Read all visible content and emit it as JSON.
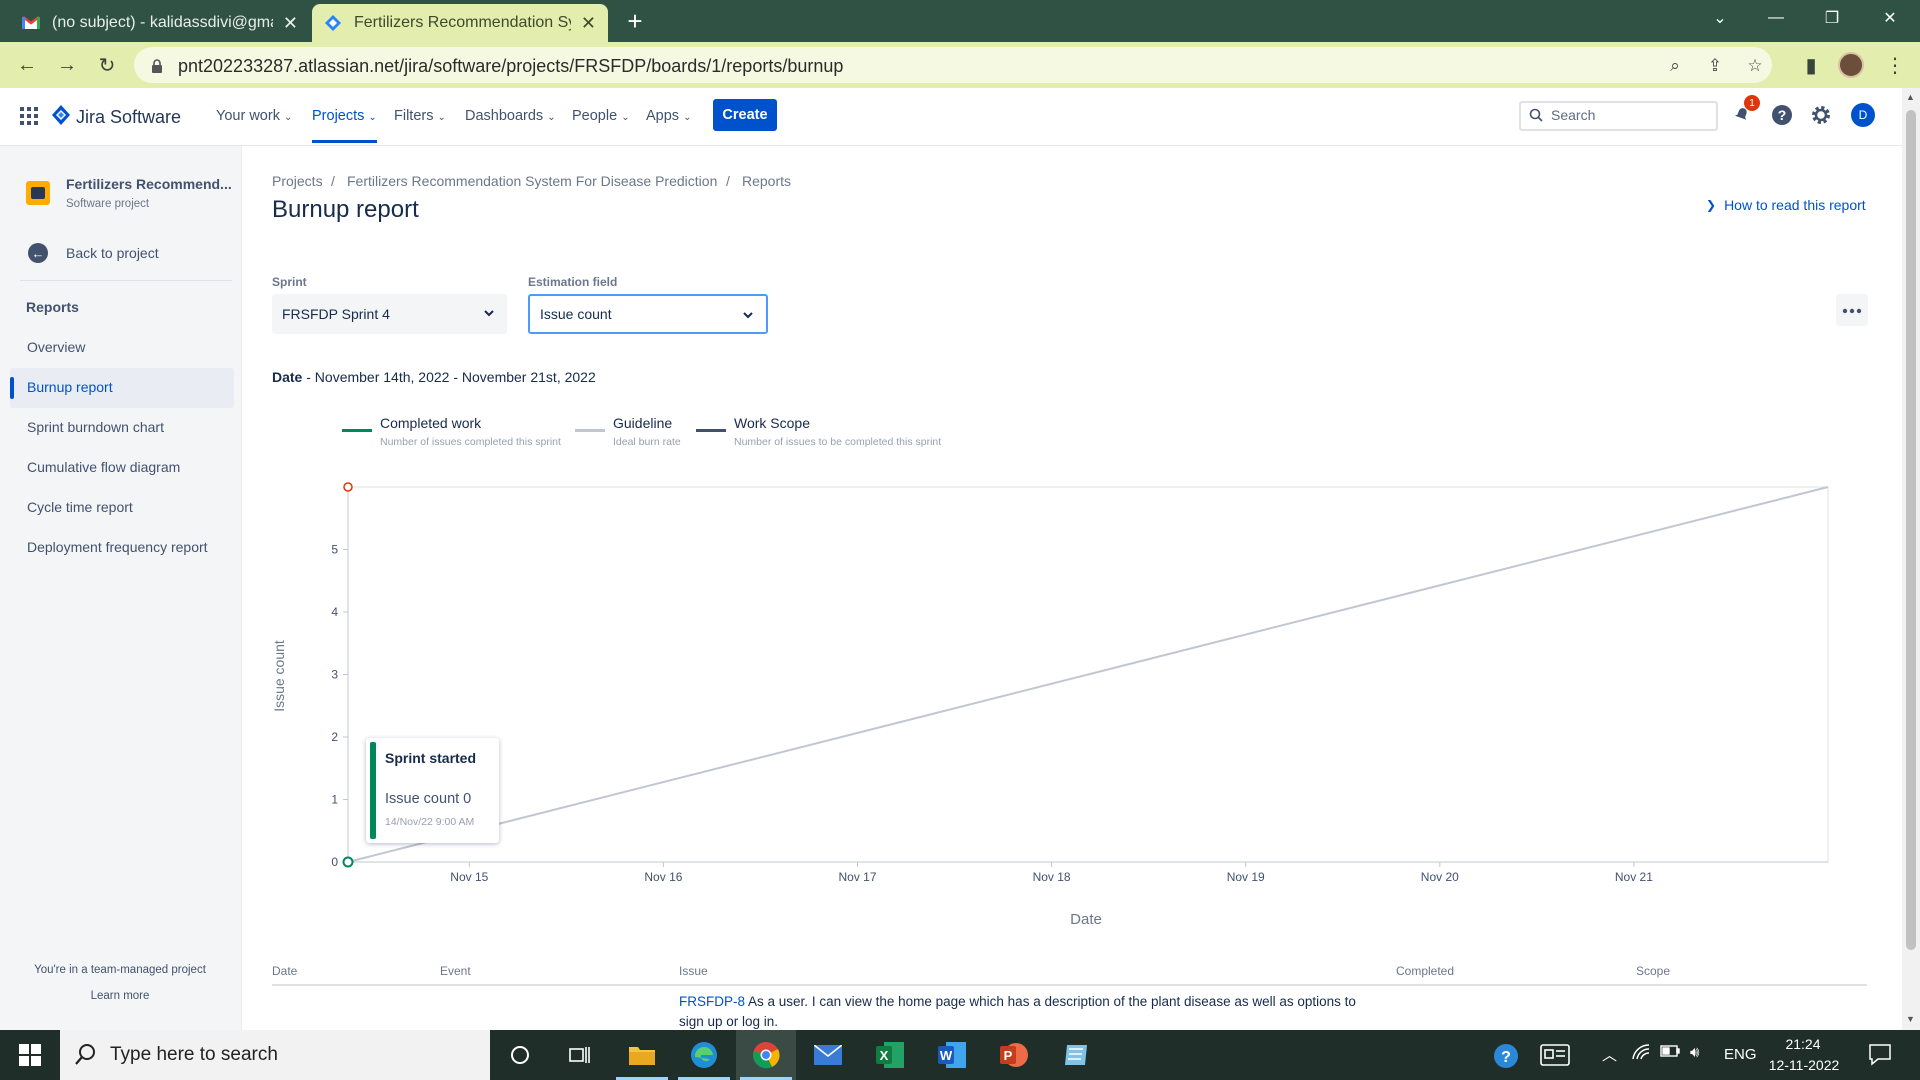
{
  "browser": {
    "tabs": [
      {
        "title": "(no subject) - kalidassdivi@gmail.com",
        "active": false,
        "icon": "gmail-icon"
      },
      {
        "title": "Fertilizers Recommendation System For Disease Prediction",
        "active": true,
        "icon": "jira-icon"
      }
    ],
    "url": "pnt202233287.atlassian.net/jira/software/projects/FRSFDP/boards/1/reports/burnup"
  },
  "jira_nav": {
    "product": "Jira Software",
    "items": [
      "Your work",
      "Projects",
      "Filters",
      "Dashboards",
      "People",
      "Apps"
    ],
    "active_item": "Projects",
    "create_label": "Create",
    "search_placeholder": "Search",
    "notification_count": "1",
    "avatar_initial": "D"
  },
  "sidebar": {
    "project_name": "Fertilizers Recommend...",
    "project_type": "Software project",
    "back_label": "Back to project",
    "section_title": "Reports",
    "items": [
      "Overview",
      "Burnup report",
      "Sprint burndown chart",
      "Cumulative flow diagram",
      "Cycle time report",
      "Deployment frequency report"
    ],
    "active_item": "Burnup report",
    "footer_text": "You're in a team-managed project",
    "footer_link": "Learn more"
  },
  "main": {
    "breadcrumb": [
      "Projects",
      "Fertilizers Recommendation System For Disease Prediction",
      "Reports"
    ],
    "title": "Burnup report",
    "help_link": "How to read this report",
    "sprint_label": "Sprint",
    "sprint_value": "FRSFDP Sprint 4",
    "estimation_label": "Estimation field",
    "estimation_value": "Issue count",
    "date_label": "Date",
    "date_range": "- November 14th, 2022 - November 21st, 2022"
  },
  "legend": [
    {
      "title": "Completed work",
      "sub": "Number of issues completed this sprint",
      "color": "#00875a"
    },
    {
      "title": "Guideline",
      "sub": "Ideal burn rate",
      "color": "#c1c7d0"
    },
    {
      "title": "Work Scope",
      "sub": "Number of issues to be completed this sprint",
      "color": "#42526e"
    }
  ],
  "chart_data": {
    "type": "line",
    "xlabel": "Date",
    "ylabel": "Issue count",
    "x_ticks": [
      "Nov 15",
      "Nov 16",
      "Nov 17",
      "Nov 18",
      "Nov 19",
      "Nov 20",
      "Nov 21"
    ],
    "y_ticks": [
      0,
      1,
      2,
      3,
      4,
      5
    ],
    "ylim": [
      0,
      6
    ],
    "xlim": [
      "2022-11-14 09:00",
      "2022-11-22 00:00"
    ],
    "series": [
      {
        "name": "Guideline",
        "x": [
          "2022-11-14 09:00",
          "2022-11-22 00:00"
        ],
        "y": [
          0,
          6
        ]
      },
      {
        "name": "Completed work",
        "x": [
          "2022-11-14 09:00"
        ],
        "y": [
          0
        ]
      },
      {
        "name": "Work Scope",
        "x": [
          "2022-11-14 09:00"
        ],
        "y": [
          6
        ]
      }
    ],
    "colors": {
      "guideline": "#c1c7d0",
      "completed": "#00875a",
      "scope": "#de350b"
    }
  },
  "tooltip": {
    "title": "Sprint started",
    "value": "Issue count 0",
    "timestamp": "14/Nov/22 9:00 AM"
  },
  "table": {
    "headers": [
      "Date",
      "Event",
      "Issue",
      "Completed",
      "Scope"
    ],
    "rows": [
      {
        "issue_key": "FRSFDP-8",
        "issue_text": "As a user. I can view the home page which has a description of the plant disease as well as options to sign up or log in."
      }
    ]
  },
  "taskbar": {
    "search_placeholder": "Type here to search",
    "language": "ENG",
    "time": "21:24",
    "date": "12-11-2022"
  }
}
